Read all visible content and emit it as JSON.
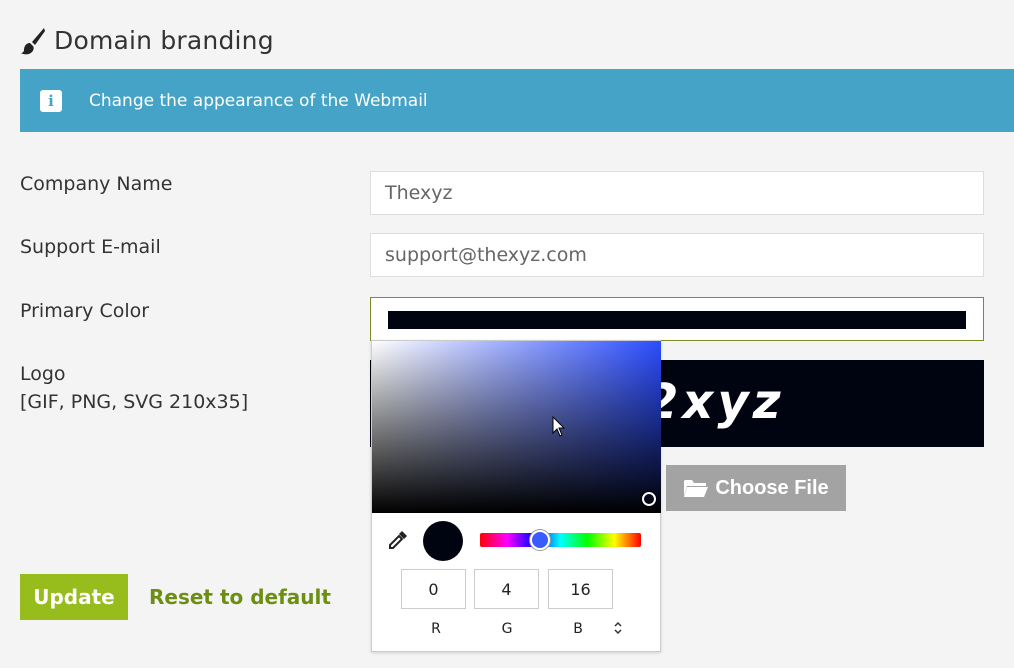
{
  "page": {
    "title": "Domain branding",
    "title_icon": "paintbrush-icon"
  },
  "banner": {
    "icon": "info-icon",
    "icon_glyph": "i",
    "text": "Change the appearance of the Webmail",
    "color": "#46a3c8"
  },
  "form": {
    "company_name": {
      "label": "Company Name",
      "value": "Thexyz"
    },
    "support_email": {
      "label": "Support E-mail",
      "value": "support@thexyz.com"
    },
    "primary_color": {
      "label": "Primary Color",
      "value": "#000410"
    },
    "logo": {
      "label": "Logo",
      "hint": "[GIF, PNG, SVG 210x35]",
      "preview_text": "2xyz",
      "choose_file_label": "Choose File",
      "choose_file_icon": "folder-open-icon"
    }
  },
  "actions": {
    "update_label": "Update",
    "reset_label": "Reset to default"
  },
  "color_picker": {
    "hue_color": "#2b4dff",
    "selected_color": "#000410",
    "eyedropper_icon": "eyedropper-icon",
    "rgb": {
      "r": {
        "label": "R",
        "value": "0"
      },
      "g": {
        "label": "G",
        "value": "4"
      },
      "b": {
        "label": "B",
        "value": "16"
      }
    },
    "mode_toggle_icon": "chevron-updown-icon",
    "mode_toggle_glyph": "⌃⌄"
  },
  "colors": {
    "update_button": "#96bd1c",
    "reset_link": "#6d8e12",
    "choose_file_button": "#a3a3a3",
    "logo_background": "#000410"
  }
}
